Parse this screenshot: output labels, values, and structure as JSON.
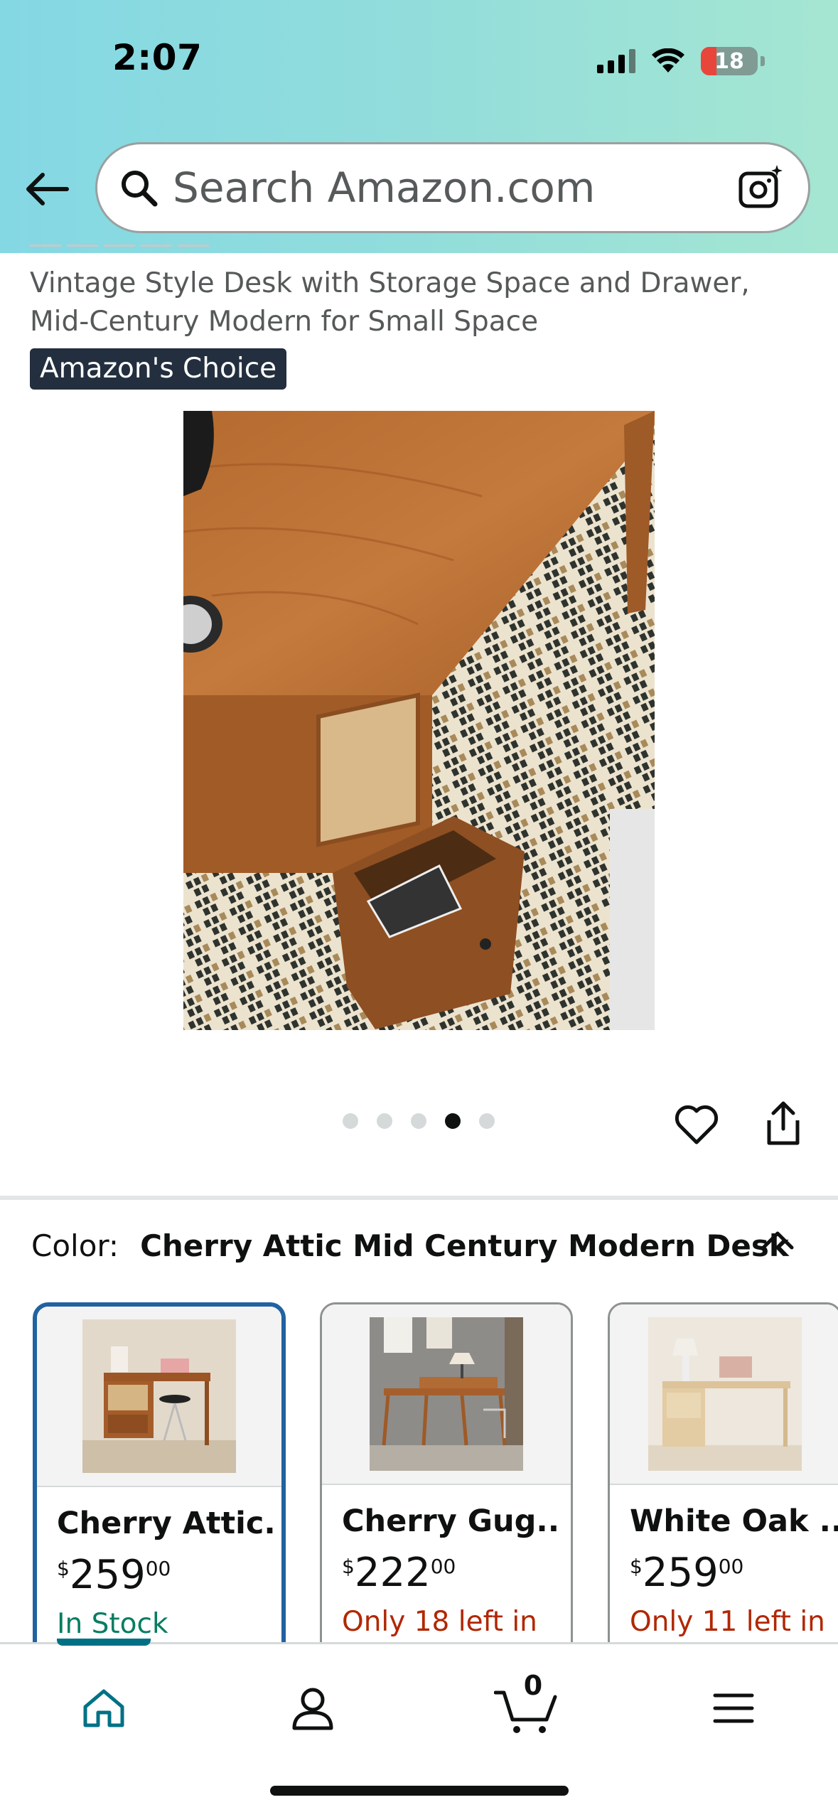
{
  "status_bar": {
    "time": "2:07",
    "battery_level": "18",
    "icons": [
      "signal-icon",
      "wifi-icon",
      "battery-icon"
    ]
  },
  "header": {
    "search_placeholder": "Search Amazon.com",
    "icons": [
      "back-arrow-icon",
      "search-icon",
      "camera-search-icon"
    ],
    "gradient_colors": [
      "#84d8e4",
      "#a5e6d2"
    ]
  },
  "product": {
    "title": "Vintage Style Desk with Storage Space and Drawer, Mid-Century Modern for Small Space",
    "badge": "Amazon's Choice",
    "image_count": 5,
    "active_image_index": 4
  },
  "actions": {
    "icons": [
      "heart-icon",
      "share-icon"
    ]
  },
  "variation": {
    "label": "Color:",
    "selected_value": "Cherry Attic Mid Century Modern Desk",
    "options": [
      {
        "title": "Cherry Attic...",
        "currency": "$",
        "whole": "259",
        "fraction": "00",
        "availability": "In Stock",
        "availability_color": "#067d62",
        "selected": true
      },
      {
        "title": "Cherry Gug...",
        "currency": "$",
        "whole": "222",
        "fraction": "00",
        "availability": "Only 18 left in",
        "availability_color": "#b12704",
        "selected": false
      },
      {
        "title": "White Oak ...",
        "currency": "$",
        "whole": "259",
        "fraction": "00",
        "availability": "Only 11 left in",
        "availability_color": "#b12704",
        "selected": false
      }
    ]
  },
  "bottom_nav": {
    "items": [
      "home-icon",
      "account-icon",
      "cart-icon",
      "menu-icon"
    ],
    "cart_count": "0",
    "accent_color": "#007185"
  }
}
